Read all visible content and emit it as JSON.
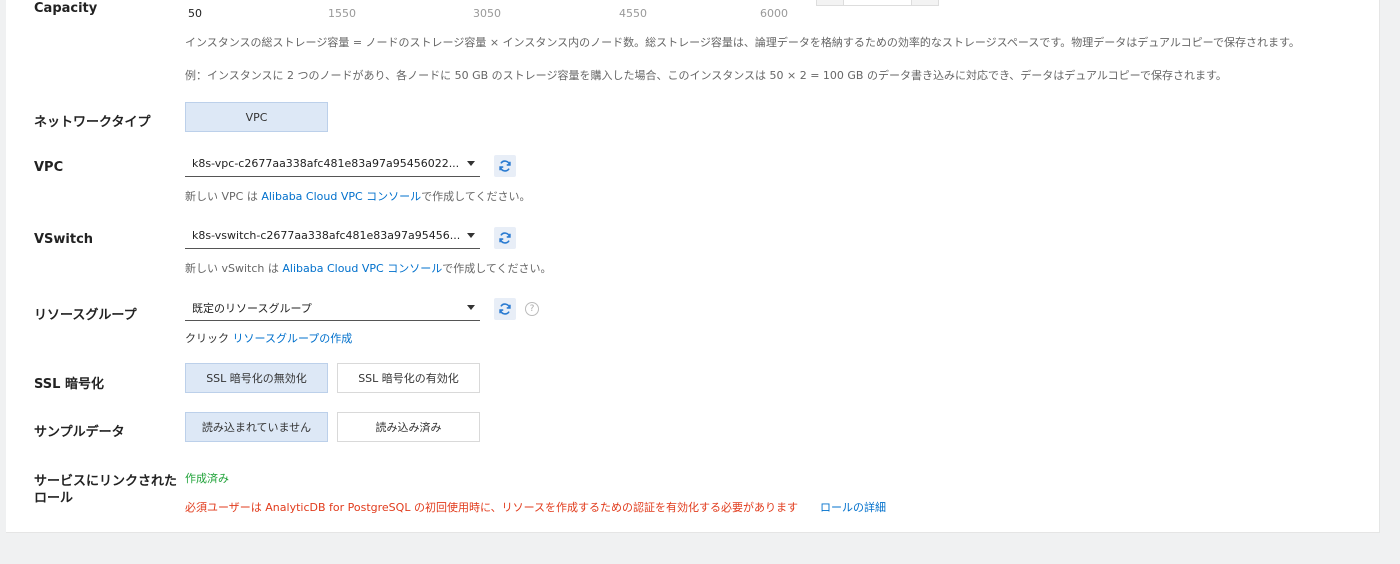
{
  "capacity": {
    "label": "Capacity",
    "ticks": [
      "50",
      "1550",
      "3050",
      "4550",
      "6000"
    ],
    "desc1": "インスタンスの総ストレージ容量 = ノードのストレージ容量 × インスタンス内のノード数。総ストレージ容量は、論理データを格納するための効率的なストレージスペースです。物理データはデュアルコピーで保存されます。",
    "desc2": "例：インスタンスに 2 つのノードがあり、各ノードに 50 GB のストレージ容量を購入した場合、このインスタンスは 50 × 2 = 100 GB のデータ書き込みに対応でき、データはデュアルコピーで保存されます。"
  },
  "network": {
    "label": "ネットワークタイプ",
    "option": "VPC"
  },
  "vpc": {
    "label": "VPC",
    "value": "k8s-vpc-c2677aa338afc481e83a97a95456022...",
    "hint_prefix": "新しい VPC は ",
    "hint_link": "Alibaba Cloud VPC コンソール",
    "hint_suffix": "で作成してください。"
  },
  "vswitch": {
    "label": "VSwitch",
    "value": "k8s-vswitch-c2677aa338afc481e83a97a95456...",
    "hint_prefix": "新しい vSwitch は ",
    "hint_link": "Alibaba Cloud VPC コンソール",
    "hint_suffix": "で作成してください。"
  },
  "resource_group": {
    "label": "リソースグループ",
    "value": "既定のリソースグループ",
    "hint_prefix": "クリック ",
    "hint_link": "リソースグループの作成",
    "help_glyph": "?"
  },
  "ssl": {
    "label": "SSL 暗号化",
    "options": [
      "SSL 暗号化の無効化",
      "SSL 暗号化の有効化"
    ],
    "selected": 0
  },
  "sample": {
    "label": "サンプルデータ",
    "options": [
      "読み込まれていません",
      "読み込み済み"
    ],
    "selected": 0
  },
  "service_role": {
    "label_line1": "サービスにリンクされた",
    "label_line2": "ロール",
    "status": "作成済み",
    "warning": "必須ユーザーは AnalyticDB for PostgreSQL の初回使用時に、リソースを作成するための認証を有効化する必要があります",
    "detail_link": "ロールの詳細"
  },
  "colors": {
    "accent": "#0070cc",
    "success": "#21a33a",
    "error": "#e13b1c",
    "selected_bg": "#dde8f6"
  }
}
